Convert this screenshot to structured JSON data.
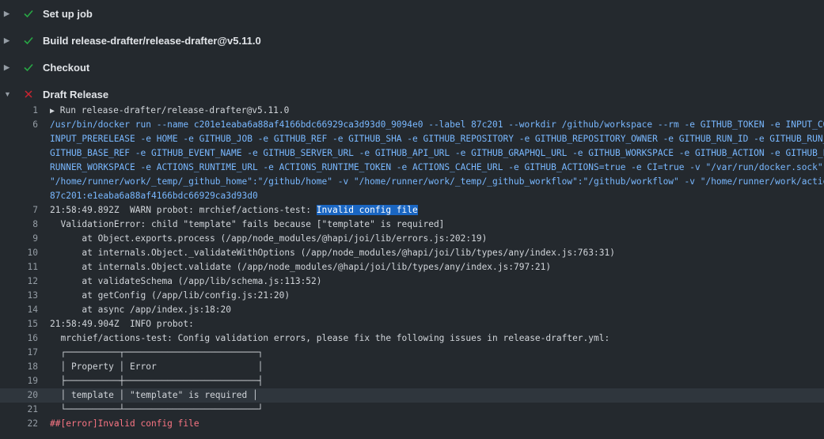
{
  "steps": [
    {
      "label": "Set up job",
      "status": "success"
    },
    {
      "label": "Build release-drafter/release-drafter@v5.11.0",
      "status": "success"
    },
    {
      "label": "Checkout",
      "status": "success"
    },
    {
      "label": "Draft Release",
      "status": "failed"
    }
  ],
  "log": {
    "line1": {
      "num": "1",
      "arrow": "▶",
      "text": " Run release-drafter/release-drafter@v5.11.0"
    },
    "line6": {
      "num": "6",
      "rows": [
        "/usr/bin/docker run --name c201e1eaba6a88af4166bdc66929ca3d93d0_9094e0 --label 87c201 --workdir /github/workspace --rm -e GITHUB_TOKEN -e INPUT_CONFIG_NAME -e",
        "INPUT_PRERELEASE -e HOME -e GITHUB_JOB -e GITHUB_REF -e GITHUB_SHA -e GITHUB_REPOSITORY -e GITHUB_REPOSITORY_OWNER -e GITHUB_RUN_ID -e GITHUB_RUN_NUMBER -e",
        "GITHUB_BASE_REF -e GITHUB_EVENT_NAME -e GITHUB_SERVER_URL -e GITHUB_API_URL -e GITHUB_GRAPHQL_URL -e GITHUB_WORKSPACE -e GITHUB_ACTION -e GITHUB_EVENT_PATH -e",
        "RUNNER_WORKSPACE -e ACTIONS_RUNTIME_URL -e ACTIONS_RUNTIME_TOKEN -e ACTIONS_CACHE_URL -e GITHUB_ACTIONS=true -e CI=true -v \"/var/run/docker.sock\":\"/var/run/docker.sock\"",
        "\"/home/runner/work/_temp/_github_home\":\"/github/home\" -v \"/home/runner/work/_temp/_github_workflow\":\"/github/workflow\" -v \"/home/runner/work/actions-test\"",
        "87c201:e1eaba6a88af4166bdc66929ca3d93d0"
      ]
    },
    "line7": {
      "num": "7",
      "prefix": "21:58:49.892Z  WARN probot: mrchief/actions-test: ",
      "selected": "Invalid config file"
    },
    "lines": [
      {
        "num": "8",
        "text": "  ValidationError: child \"template\" fails because [\"template\" is required]"
      },
      {
        "num": "9",
        "text": "      at Object.exports.process (/app/node_modules/@hapi/joi/lib/errors.js:202:19)"
      },
      {
        "num": "10",
        "text": "      at internals.Object._validateWithOptions (/app/node_modules/@hapi/joi/lib/types/any/index.js:763:31)"
      },
      {
        "num": "11",
        "text": "      at internals.Object.validate (/app/node_modules/@hapi/joi/lib/types/any/index.js:797:21)"
      },
      {
        "num": "12",
        "text": "      at validateSchema (/app/lib/schema.js:113:52)"
      },
      {
        "num": "13",
        "text": "      at getConfig (/app/lib/config.js:21:20)"
      },
      {
        "num": "14",
        "text": "      at async /app/index.js:18:20"
      },
      {
        "num": "15",
        "text": "21:58:49.904Z  INFO probot:"
      },
      {
        "num": "16",
        "text": "  mrchief/actions-test: Config validation errors, please fix the following issues in release-drafter.yml:"
      },
      {
        "num": "17",
        "text": "  ┌──────────┬─────────────────────────┐"
      },
      {
        "num": "18",
        "text": "  │ Property │ Error                   │"
      },
      {
        "num": "19",
        "text": "  ├──────────┼─────────────────────────┤"
      },
      {
        "num": "20",
        "text": "  │ template │ \"template\" is required │"
      },
      {
        "num": "21",
        "text": "  └──────────┴─────────────────────────┘"
      }
    ],
    "line22": {
      "num": "22",
      "text": "##[error]Invalid config file"
    }
  }
}
